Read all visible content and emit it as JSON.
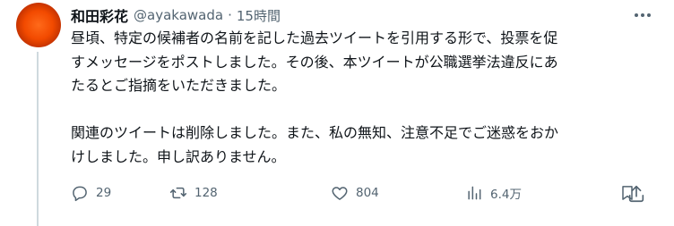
{
  "author": {
    "display_name": "和田彩花",
    "handle": "@ayakawada",
    "separator": "·",
    "time": "15時間"
  },
  "tweet": {
    "text": "昼頃、特定の候補者の名前を記した過去ツイートを引用する形で、投票を促\nすメッセージをポストしました。その後、本ツイートが公職選挙法違反にあ\nたるとご指摘をいただきました。\n\n関連のツイートは削除しました。また、私の無知、注意不足でご迷惑をおか\nけしました。申し訳ありません。"
  },
  "actions": {
    "reply_count": "29",
    "retweet_count": "128",
    "like_count": "804",
    "view_count": "6.4万"
  },
  "icons": [
    "more-icon",
    "reply-icon",
    "retweet-icon",
    "like-icon",
    "views-icon",
    "bookmark-icon",
    "share-icon"
  ],
  "colors": {
    "text_primary": "#0f1419",
    "text_secondary": "#536471",
    "thread_line": "#cfd9de",
    "avatar_accent": "#f24a00"
  }
}
